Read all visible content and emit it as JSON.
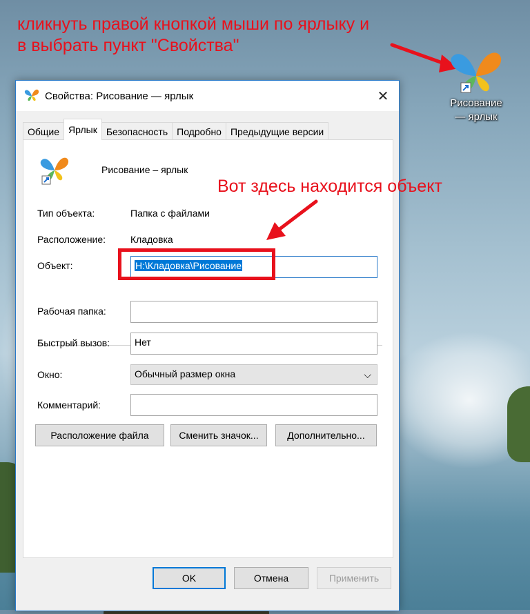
{
  "annotations": {
    "line1": "кликнуть правой кнопкой мыши по ярлыку и",
    "line2": "в выбрать пункт \"Свойства\"",
    "object_hint": "Вот здесь находится объект"
  },
  "desktop_icon": {
    "line1": "Рисование",
    "line2": "— ярлык",
    "icon": "butterfly-shortcut-icon"
  },
  "dialog": {
    "title": "Свойства: Рисование — ярлык",
    "tabs": [
      "Общие",
      "Ярлык",
      "Безопасность",
      "Подробно",
      "Предыдущие версии"
    ],
    "active_tab": "Ярлык",
    "shortcut_name": "Рисование – ярлык",
    "fields": {
      "type_label": "Тип объекта:",
      "type_value": "Папка с файлами",
      "location_label": "Расположение:",
      "location_value": "Кладовка",
      "object_label": "Объект:",
      "object_value": "H:\\Кладовка\\Рисование",
      "workdir_label": "Рабочая папка:",
      "workdir_value": "",
      "hotkey_label": "Быстрый вызов:",
      "hotkey_value": "Нет",
      "window_label": "Окно:",
      "window_value": "Обычный размер окна",
      "comment_label": "Комментарий:",
      "comment_value": ""
    },
    "buttons": {
      "file_location": "Расположение файла",
      "change_icon": "Сменить значок...",
      "advanced": "Дополнительно...",
      "ok": "OK",
      "cancel": "Отмена",
      "apply": "Применить"
    }
  },
  "colors": {
    "annotation": "#e8111c",
    "accent": "#0078d7"
  }
}
